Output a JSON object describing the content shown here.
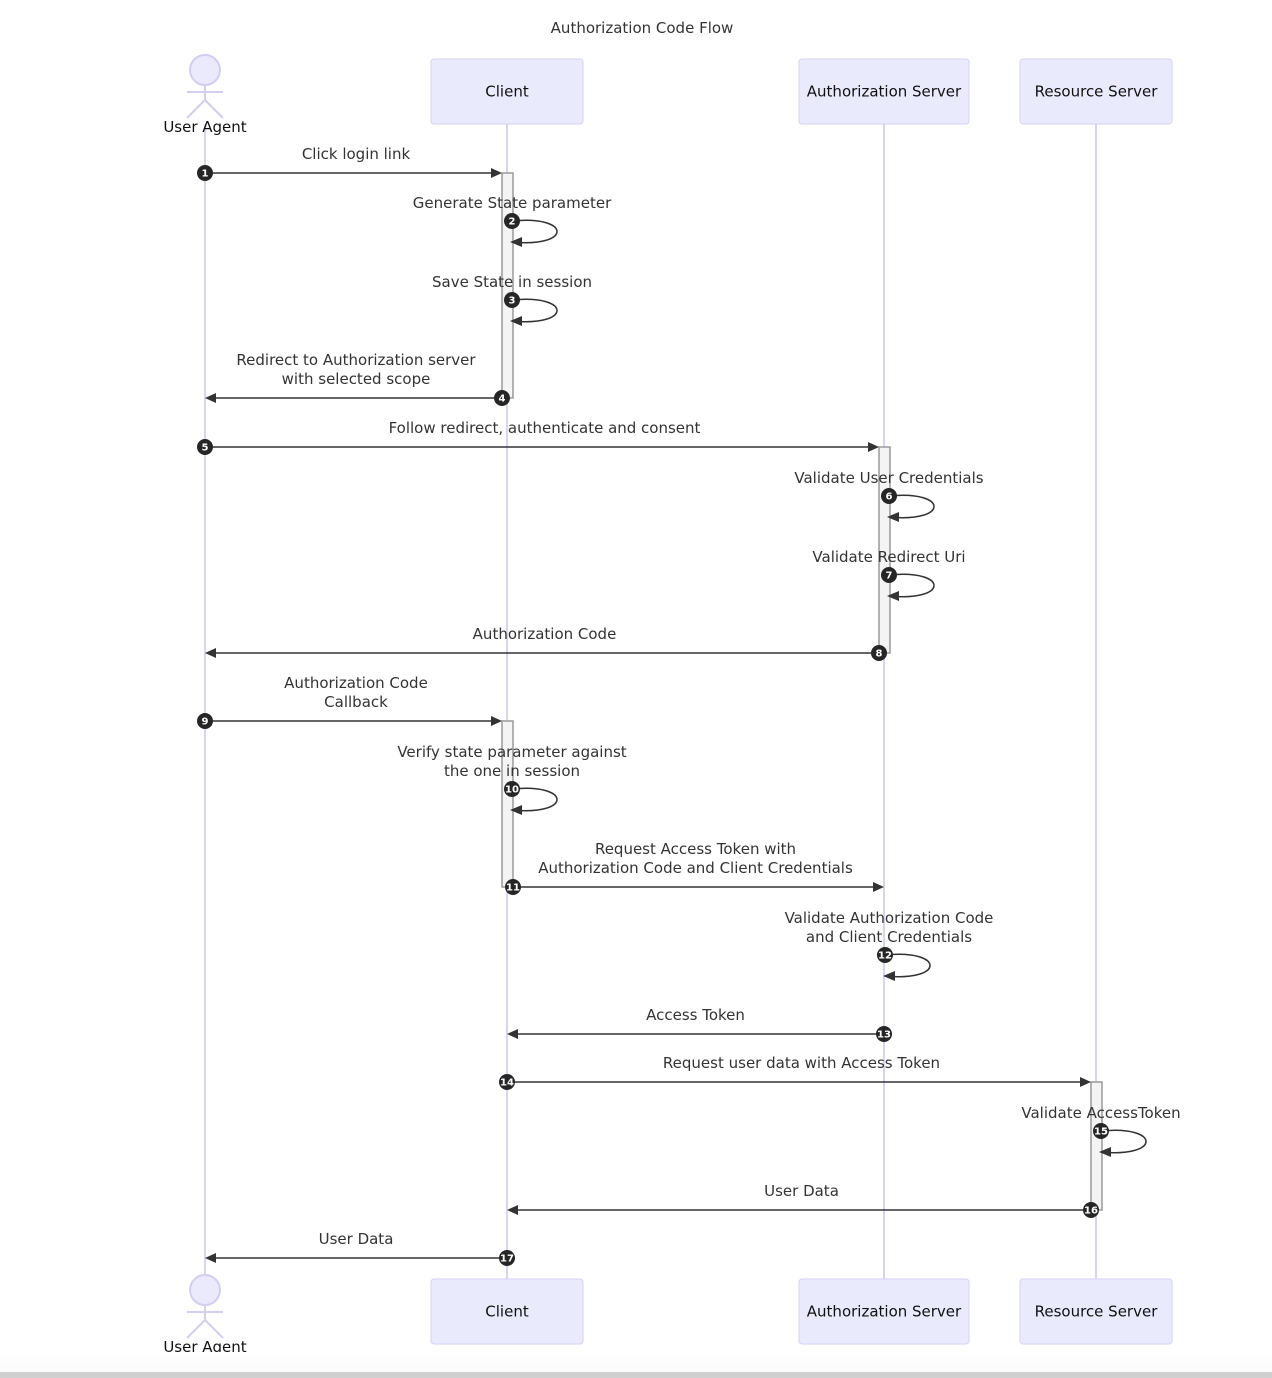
{
  "title": "Authorization Code Flow",
  "participants": [
    {
      "id": "ua",
      "label": "User Agent",
      "kind": "actor"
    },
    {
      "id": "client",
      "label": "Client",
      "kind": "box"
    },
    {
      "id": "as",
      "label": "Authorization Server",
      "kind": "box"
    },
    {
      "id": "rs",
      "label": "Resource Server",
      "kind": "box"
    }
  ],
  "messages": [
    {
      "n": "1",
      "from": "ua",
      "to": "client",
      "lines": [
        "Click login link"
      ]
    },
    {
      "n": "2",
      "from": "client",
      "to": "client",
      "lines": [
        "Generate State parameter"
      ]
    },
    {
      "n": "3",
      "from": "client",
      "to": "client",
      "lines": [
        "Save State in session"
      ]
    },
    {
      "n": "4",
      "from": "client",
      "to": "ua",
      "lines": [
        "Redirect to Authorization server",
        "with selected scope"
      ]
    },
    {
      "n": "5",
      "from": "ua",
      "to": "as",
      "lines": [
        "Follow redirect, authenticate and consent"
      ]
    },
    {
      "n": "6",
      "from": "as",
      "to": "as",
      "lines": [
        "Validate User Credentials"
      ]
    },
    {
      "n": "7",
      "from": "as",
      "to": "as",
      "lines": [
        "Validate Redirect Uri"
      ]
    },
    {
      "n": "8",
      "from": "as",
      "to": "ua",
      "lines": [
        "Authorization Code"
      ]
    },
    {
      "n": "9",
      "from": "ua",
      "to": "client",
      "lines": [
        "Authorization Code",
        "Callback"
      ]
    },
    {
      "n": "10",
      "from": "client",
      "to": "client",
      "lines": [
        "Verify state parameter against",
        "the one in session"
      ]
    },
    {
      "n": "11",
      "from": "client",
      "to": "as",
      "lines": [
        "Request Access Token with",
        "Authorization Code and Client Credentials"
      ]
    },
    {
      "n": "12",
      "from": "as",
      "to": "as",
      "lines": [
        "Validate Authorization Code",
        "and Client Credentials"
      ]
    },
    {
      "n": "13",
      "from": "as",
      "to": "client",
      "lines": [
        "Access Token"
      ]
    },
    {
      "n": "14",
      "from": "client",
      "to": "rs",
      "lines": [
        "Request user data with Access Token"
      ]
    },
    {
      "n": "15",
      "from": "rs",
      "to": "rs",
      "lines": [
        "Validate AccessToken"
      ]
    },
    {
      "n": "16",
      "from": "rs",
      "to": "client",
      "lines": [
        "User Data"
      ]
    },
    {
      "n": "17",
      "from": "client",
      "to": "ua",
      "lines": [
        "User Data"
      ]
    }
  ],
  "activations": [
    {
      "participant": "client",
      "from_message": "1",
      "to_message": "4"
    },
    {
      "participant": "as",
      "from_message": "5",
      "to_message": "8"
    },
    {
      "participant": "client",
      "from_message": "9",
      "to_message": "11"
    },
    {
      "participant": "rs",
      "from_message": "14",
      "to_message": "16"
    }
  ],
  "colors": {
    "participant_fill": "#eaeafd",
    "participant_border": "#d6d1f2",
    "lifeline": "#d9d2f3",
    "message_line": "#333333",
    "badge": "#262626",
    "activation_fill": "#f4f4f4"
  }
}
